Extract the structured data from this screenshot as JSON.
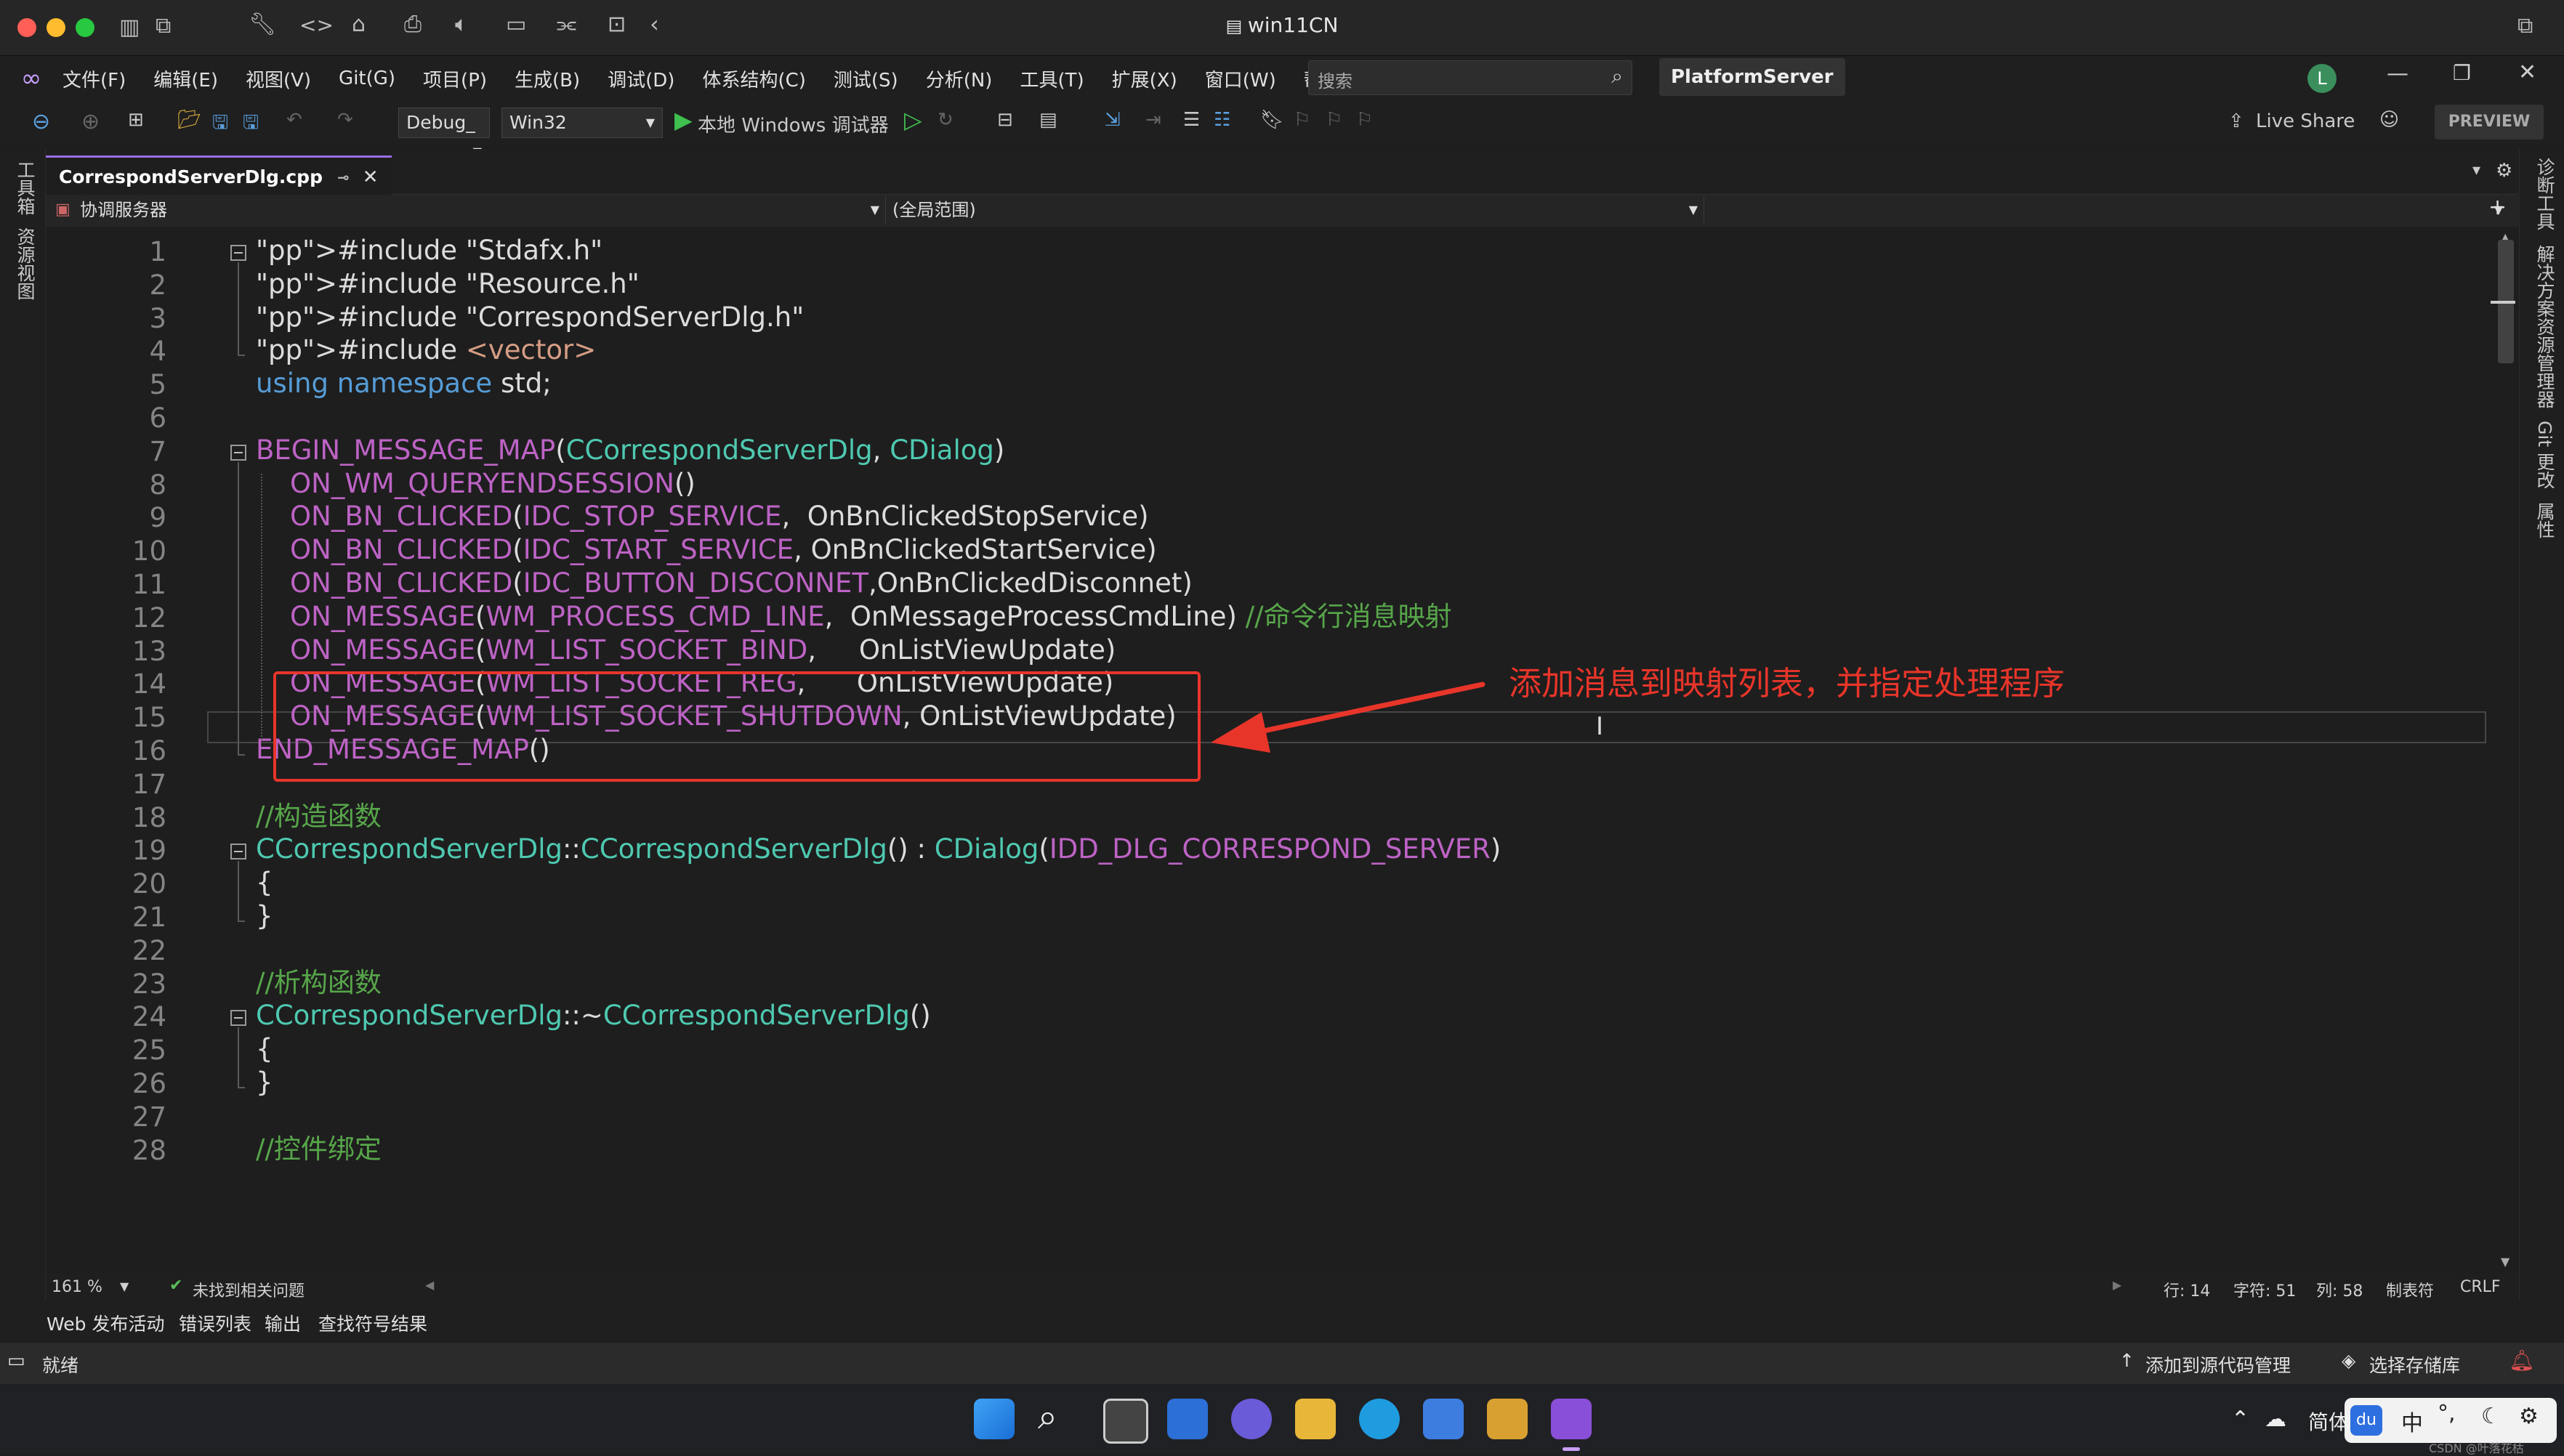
{
  "window": {
    "title": "win11CN"
  },
  "menubar": {
    "items": [
      "文件(F)",
      "编辑(E)",
      "视图(V)",
      "Git(G)",
      "项目(P)",
      "生成(B)",
      "调试(D)",
      "体系结构(C)",
      "测试(S)",
      "分析(N)",
      "工具(T)",
      "扩展(X)",
      "窗口(W)",
      "帮助(H)"
    ],
    "search_placeholder": "搜索",
    "project": "PlatformServer",
    "avatar_letter": "L"
  },
  "toolbar": {
    "config": "Debug_",
    "platform": "Win32",
    "run_label": "本地 Windows 调试器",
    "live_share": "Live Share",
    "preview": "PREVIEW"
  },
  "left_strip": {
    "items": [
      "工具箱",
      "资源视图"
    ]
  },
  "right_strip": {
    "items": [
      "诊断工具",
      "解决方案资源管理器",
      "Git 更改",
      "属性"
    ]
  },
  "editor": {
    "tab_name": "CorrespondServerDlg.cpp",
    "nav_scope": "协调服务器",
    "nav_global": "(全局范围)",
    "lines": [
      "#include \"Stdafx.h\"",
      "#include \"Resource.h\"",
      "#include \"CorrespondServerDlg.h\"",
      "#include <vector>",
      "using namespace std;",
      "",
      "BEGIN_MESSAGE_MAP(CCorrespondServerDlg, CDialog)",
      "    ON_WM_QUERYENDSESSION()",
      "    ON_BN_CLICKED(IDC_STOP_SERVICE,  OnBnClickedStopService)",
      "    ON_BN_CLICKED(IDC_START_SERVICE, OnBnClickedStartService)",
      "    ON_BN_CLICKED(IDC_BUTTON_DISCONNET,OnBnClickedDisconnet)",
      "    ON_MESSAGE(WM_PROCESS_CMD_LINE,  OnMessageProcessCmdLine) //命令行消息映射",
      "    ON_MESSAGE(WM_LIST_SOCKET_BIND,     OnListViewUpdate)",
      "    ON_MESSAGE(WM_LIST_SOCKET_REG,      OnListViewUpdate)",
      "    ON_MESSAGE(WM_LIST_SOCKET_SHUTDOWN, OnListViewUpdate)",
      "END_MESSAGE_MAP()",
      "",
      "//构造函数",
      "CCorrespondServerDlg::CCorrespondServerDlg() : CDialog(IDD_DLG_CORRESPOND_SERVER)",
      "{",
      "}",
      "",
      "//析构函数",
      "CCorrespondServerDlg::~CCorrespondServerDlg()",
      "{",
      "}",
      "",
      "//控件绑定"
    ]
  },
  "annotation": {
    "text": "添加消息到映射列表，并指定处理程序"
  },
  "editor_status": {
    "zoom": "161 %",
    "issues": "未找到相关问题",
    "row": "行: 14",
    "char": "字符: 51",
    "col": "列: 58",
    "tab_mode": "制表符",
    "eol": "CRLF"
  },
  "output_tabs": [
    "Web 发布活动",
    "错误列表",
    "输出",
    "查找符号结果"
  ],
  "statusbar": {
    "ready": "就绪",
    "add_source": "添加到源代码管理",
    "select_repo": "选择存储库"
  },
  "taskbar": {
    "ime": "简体",
    "ime_mode": "中",
    "watermark": "CSDN @叶落花枯"
  },
  "colors": {
    "accent": "#9a6ee6",
    "annotation": "#e8352a"
  }
}
